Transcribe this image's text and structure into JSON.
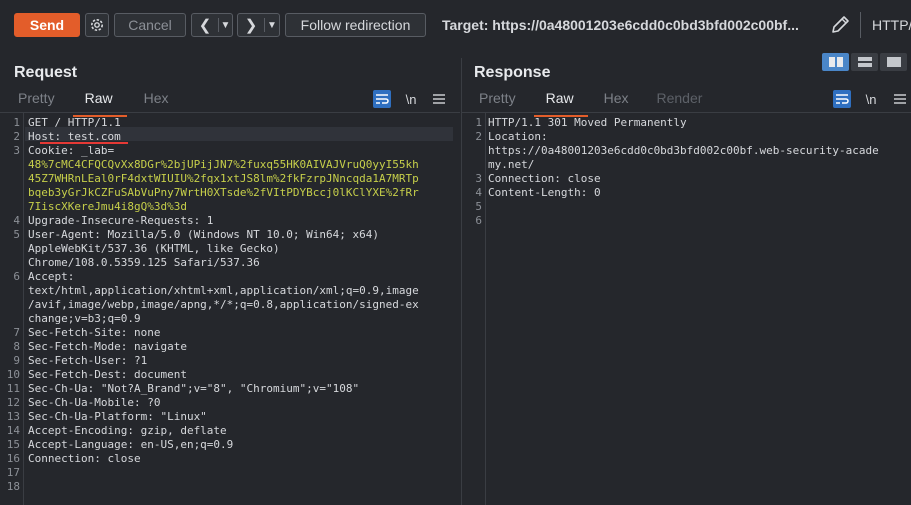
{
  "toolbar": {
    "send_label": "Send",
    "cancel_label": "Cancel",
    "follow_label": "Follow redirection",
    "target_label": "Target: https://0a48001203e6cdd0c0bd3bfd002c00bf...",
    "http_version_label": "HTTP/"
  },
  "request": {
    "title": "Request",
    "tabs": [
      "Pretty",
      "Raw",
      "Hex"
    ],
    "active_tab": "Raw",
    "newline_toggle": "\\n",
    "line_numbers": [
      "1",
      "2",
      "3",
      "4",
      "5",
      "6",
      "7",
      "8",
      "9",
      "10",
      "11",
      "12",
      "13",
      "14",
      "15",
      "16",
      "17",
      "18"
    ],
    "lines": [
      "GET / HTTP/1.1",
      "Host: test.com",
      "Cookie: _lab=",
      "48%7cMC4CFQCQvXx8DGr%2bjUPijJN7%2fuxq55HK0AIVAJVruQ0yyI55kh",
      "45Z7WHRnLEal0rF4dxtWIUIU%2fqx1xtJS8lm%2fkFzrpJNncqda1A7MRTp",
      "bqeb3yGrJkCZFuSAbVuPny7WrtH0XTsde%2fVItPDYBccj0lKClYXE%2fRr",
      "7IiscXKereJmu4i8gQ%3d%3d",
      "Upgrade-Insecure-Requests: 1",
      "User-Agent: Mozilla/5.0 (Windows NT 10.0; Win64; x64)",
      "AppleWebKit/537.36 (KHTML, like Gecko)",
      "Chrome/108.0.5359.125 Safari/537.36",
      "Accept:",
      "text/html,application/xhtml+xml,application/xml;q=0.9,image",
      "/avif,image/webp,image/apng,*/*;q=0.8,application/signed-ex",
      "change;v=b3;q=0.9",
      "Sec-Fetch-Site: none",
      "Sec-Fetch-Mode: navigate",
      "Sec-Fetch-User: ?1",
      "Sec-Fetch-Dest: document",
      "Sec-Ch-Ua: \"Not?A_Brand\";v=\"8\", \"Chromium\";v=\"108\"",
      "Sec-Ch-Ua-Mobile: ?0",
      "Sec-Ch-Ua-Platform: \"Linux\"",
      "Accept-Encoding: gzip, deflate",
      "Accept-Language: en-US,en;q=0.9",
      "Connection: close"
    ]
  },
  "response": {
    "title": "Response",
    "tabs": [
      "Pretty",
      "Raw",
      "Hex",
      "Render"
    ],
    "active_tab": "Raw",
    "newline_toggle": "\\n",
    "line_numbers": [
      "1",
      "2",
      "3",
      "4",
      "5",
      "6"
    ],
    "lines": [
      "HTTP/1.1 301 Moved Permanently",
      "Location:",
      "https://0a48001203e6cdd0c0bd3bfd002c00bf.web-security-acade",
      "my.net/",
      "Connection: close",
      "Content-Length: 0"
    ]
  },
  "colors": {
    "background": "#25272c",
    "accent": "#e35d2a",
    "cookie_value": "#c6cf4a",
    "active_toggle": "#4a86c8",
    "highlight_underline": "#e53935"
  },
  "icons": [
    "gear-icon",
    "chevron-left-icon",
    "chevron-right-icon",
    "dropdown-icon",
    "pencil-icon",
    "word-wrap-icon",
    "menu-icon",
    "layout-side-by-side-icon",
    "layout-stacked-icon",
    "layout-single-icon"
  ]
}
